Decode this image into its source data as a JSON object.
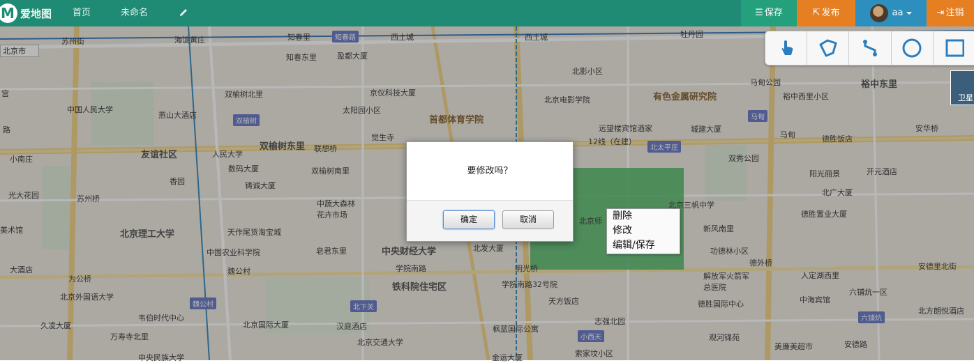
{
  "app": {
    "name": "爱地图",
    "logo_letter": "M"
  },
  "nav": {
    "home": "首页",
    "map_title": "未命名"
  },
  "toolbar": {
    "save": "保存",
    "publish": "发布",
    "user": "aa",
    "logout": "注销"
  },
  "map": {
    "city": "北京市",
    "satellite": "卫星",
    "labels": [
      {
        "text": "苏州街",
        "kind": "normal"
      },
      {
        "text": "海淀黄庄",
        "kind": "normal"
      },
      {
        "text": "知春里",
        "kind": "normal"
      },
      {
        "text": "知春路",
        "kind": "normal"
      },
      {
        "text": "西土城",
        "kind": "normal"
      },
      {
        "text": "牡丹园",
        "kind": "normal"
      },
      {
        "text": "知春东里",
        "kind": "normal"
      },
      {
        "text": "盈都大厦",
        "kind": "normal"
      },
      {
        "text": "北影小区",
        "kind": "normal"
      },
      {
        "text": "双榆树北里",
        "kind": "normal"
      },
      {
        "text": "京仪科技大厦",
        "kind": "normal"
      },
      {
        "text": "北京电影学院",
        "kind": "normal"
      },
      {
        "text": "有色金属研究院",
        "kind": "brown"
      },
      {
        "text": "马甸公园",
        "kind": "normal"
      },
      {
        "text": "裕中东里",
        "kind": "big"
      },
      {
        "text": "裕中西里小区",
        "kind": "normal"
      },
      {
        "text": "中国人民大学",
        "kind": "normal"
      },
      {
        "text": "燕山大酒店",
        "kind": "normal"
      },
      {
        "text": "太阳园小区",
        "kind": "normal"
      },
      {
        "text": "首都体育学院",
        "kind": "brown"
      },
      {
        "text": "远望楼宾馆酒家",
        "kind": "normal"
      },
      {
        "text": "城建大厦",
        "kind": "normal"
      },
      {
        "text": "马甸",
        "kind": "normal"
      },
      {
        "text": "安华桥",
        "kind": "normal"
      },
      {
        "text": "觉生寺",
        "kind": "normal"
      },
      {
        "text": "德胜饭店",
        "kind": "normal"
      },
      {
        "text": "友谊社区",
        "kind": "big"
      },
      {
        "text": "人民大学",
        "kind": "normal"
      },
      {
        "text": "双榆树东里",
        "kind": "big"
      },
      {
        "text": "联想桥",
        "kind": "normal"
      },
      {
        "text": "12线（在建）",
        "kind": "normal"
      },
      {
        "text": "双秀公园",
        "kind": "normal"
      },
      {
        "text": "小南庄",
        "kind": "normal"
      },
      {
        "text": "数码大厦",
        "kind": "normal"
      },
      {
        "text": "双榆树南里",
        "kind": "normal"
      },
      {
        "text": "阳光丽景",
        "kind": "normal"
      },
      {
        "text": "开元酒店",
        "kind": "normal"
      },
      {
        "text": "光大花园",
        "kind": "normal"
      },
      {
        "text": "香园",
        "kind": "normal"
      },
      {
        "text": "铸诚大厦",
        "kind": "normal"
      },
      {
        "text": "北广大厦",
        "kind": "normal"
      },
      {
        "text": "苏州桥",
        "kind": "normal"
      },
      {
        "text": "中蔬大森林花卉市场",
        "kind": "normal"
      },
      {
        "text": "北京三帆中学",
        "kind": "normal"
      },
      {
        "text": "德胜置业大厦",
        "kind": "normal"
      },
      {
        "text": "美术馆",
        "kind": "normal"
      },
      {
        "text": "北京理工大学",
        "kind": "big"
      },
      {
        "text": "天作尾货淘宝城",
        "kind": "normal"
      },
      {
        "text": "北京师",
        "kind": "normal"
      },
      {
        "text": "新风南里",
        "kind": "normal"
      },
      {
        "text": "中国农业科学院",
        "kind": "normal"
      },
      {
        "text": "皂君东里",
        "kind": "normal"
      },
      {
        "text": "中央财经大学",
        "kind": "big"
      },
      {
        "text": "北发大厦",
        "kind": "normal"
      },
      {
        "text": "功德林小区",
        "kind": "normal"
      },
      {
        "text": "大酒店",
        "kind": "normal"
      },
      {
        "text": "魏公村",
        "kind": "normal"
      },
      {
        "text": "学院南路",
        "kind": "normal"
      },
      {
        "text": "明光桥",
        "kind": "normal"
      },
      {
        "text": "德外桥",
        "kind": "normal"
      },
      {
        "text": "安德里北街",
        "kind": "normal"
      },
      {
        "text": "为公桥",
        "kind": "normal"
      },
      {
        "text": "铁科院住宅区",
        "kind": "big"
      },
      {
        "text": "学院南路32号院",
        "kind": "normal"
      },
      {
        "text": "解放军火箭军总医院",
        "kind": "normal"
      },
      {
        "text": "人定湖西里",
        "kind": "normal"
      },
      {
        "text": "北京外国语大学",
        "kind": "normal"
      },
      {
        "text": "天方饭店",
        "kind": "normal"
      },
      {
        "text": "六铺炕一区",
        "kind": "normal"
      },
      {
        "text": "德胜国际中心",
        "kind": "normal"
      },
      {
        "text": "中海宾馆",
        "kind": "normal"
      },
      {
        "text": "韦伯时代中心",
        "kind": "normal"
      },
      {
        "text": "志强北园",
        "kind": "normal"
      },
      {
        "text": "六铺炕",
        "kind": "normal"
      },
      {
        "text": "久凌大厦",
        "kind": "normal"
      },
      {
        "text": "北京国际大厦",
        "kind": "normal"
      },
      {
        "text": "汉庭酒店",
        "kind": "normal"
      },
      {
        "text": "枫蓝国际公寓",
        "kind": "normal"
      },
      {
        "text": "观河锦苑",
        "kind": "normal"
      },
      {
        "text": "北方朗悦酒店",
        "kind": "normal"
      },
      {
        "text": "万寿寺北里",
        "kind": "normal"
      },
      {
        "text": "北京交通大学",
        "kind": "normal"
      },
      {
        "text": "索家坟小区",
        "kind": "normal"
      },
      {
        "text": "美廉美超市",
        "kind": "normal"
      },
      {
        "text": "安德路",
        "kind": "normal"
      },
      {
        "text": "中央民族大学",
        "kind": "normal"
      },
      {
        "text": "金运大厦",
        "kind": "normal"
      },
      {
        "text": "路",
        "kind": "normal"
      },
      {
        "text": "宫",
        "kind": "normal"
      }
    ],
    "stations": [
      "知春路",
      "双榆树",
      "北太平庄",
      "马甸",
      "魏公村",
      "北下关",
      "小西天",
      "六铺炕"
    ]
  },
  "tools": [
    "pan-hand-icon",
    "polygon-icon",
    "polyline-icon",
    "circle-icon",
    "rectangle-icon"
  ],
  "context_menu": {
    "delete": "删除",
    "modify": "修改",
    "edit_save": "编辑/保存"
  },
  "dialog": {
    "message": "要修改吗？",
    "ok": "确定",
    "cancel": "取消"
  },
  "colors": {
    "topbar": "#1f8b74",
    "save": "#24a07c",
    "publish": "#e67e22",
    "user": "#2d8fbd",
    "polygon": "#4cb864"
  }
}
